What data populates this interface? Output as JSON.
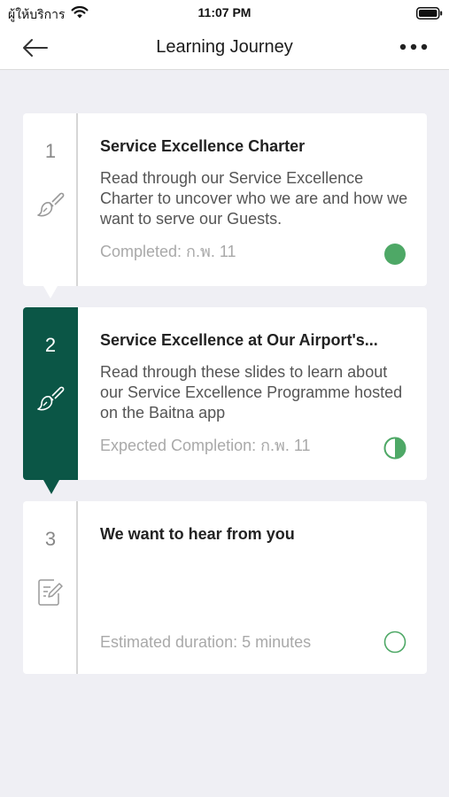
{
  "status_bar": {
    "carrier": "ผู้ให้บริการ",
    "time": "11:07 PM"
  },
  "nav": {
    "title": "Learning Journey"
  },
  "colors": {
    "brand_green": "#0b5646",
    "status_green": "#4ea866"
  },
  "steps": [
    {
      "number": "1",
      "icon": "brush-icon",
      "title": "Service Excellence Charter",
      "description": "Read through our Service Excellence Charter to uncover who we are and how we want to serve our Guests.",
      "status": "Completed: ก.พ. 11",
      "state": "completed",
      "progress": 1
    },
    {
      "number": "2",
      "icon": "brush-icon",
      "title": "Service Excellence at Our Airport's...",
      "description": "Read through these slides to learn about our Service Excellence Programme hosted on the Baitna app",
      "status": "Expected Completion: ก.พ. 11",
      "state": "in-progress",
      "progress": 0.5
    },
    {
      "number": "3",
      "icon": "survey-edit-icon",
      "title": "We want to hear from you",
      "description": "",
      "status": "Estimated duration: 5 minutes",
      "state": "not-started",
      "progress": 0
    }
  ]
}
